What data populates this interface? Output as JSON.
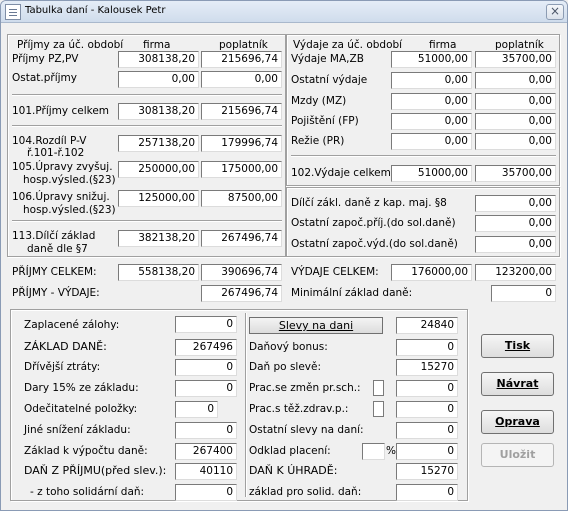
{
  "window": {
    "title": "Tabulka daní - Kalousek Petr",
    "close": "×"
  },
  "prijmy": {
    "header": "Příjmy za úč. období",
    "col_firma": "firma",
    "col_poplatnik": "poplatník",
    "pz_pv": {
      "label": "Příjmy PZ,PV",
      "firma": "308138,20",
      "poplatnik": "215696,74"
    },
    "ostat": {
      "label": "Ostat.příjmy",
      "firma": "0,00",
      "poplatnik": "0,00"
    },
    "celkem101": {
      "label": "101.Příjmy celkem",
      "firma": "308138,20",
      "poplatnik": "215696,74"
    },
    "rozdil104": {
      "label1": "104.Rozdíl P-V",
      "label2": "ř.101-ř.102",
      "firma": "257138,20",
      "poplatnik": "179996,74"
    },
    "upravy105": {
      "label1": "105.Úpravy zvyšuj.",
      "label2": "hosp.výsled.(§23)",
      "firma": "250000,00",
      "poplatnik": "175000,00"
    },
    "upravy106": {
      "label1": "106.Úpravy snižuj.",
      "label2": "hosp.výsled.(§23)",
      "firma": "125000,00",
      "poplatnik": "87500,00"
    },
    "zaklad113": {
      "label1": "113.Dílčí základ",
      "label2": "daně dle §7",
      "firma": "382138,20",
      "poplatnik": "267496,74"
    }
  },
  "vydaje": {
    "header": "Výdaje za úč. období",
    "col_firma": "firma",
    "col_poplatnik": "poplatník",
    "ma_zb": {
      "label": "Výdaje MA,ZB",
      "firma": "51000,00",
      "poplatnik": "35700,00"
    },
    "ostatni": {
      "label": "Ostatní výdaje",
      "firma": "0,00",
      "poplatnik": "0,00"
    },
    "mzdy": {
      "label": "Mzdy (MZ)",
      "firma": "0,00",
      "poplatnik": "0,00"
    },
    "pojisteni": {
      "label": "Pojištění (FP)",
      "firma": "0,00",
      "poplatnik": "0,00"
    },
    "rezie": {
      "label": "Režie (PR)",
      "firma": "0,00",
      "poplatnik": "0,00"
    },
    "celkem102": {
      "label": "102.Výdaje celkem",
      "firma": "51000,00",
      "poplatnik": "35700,00"
    }
  },
  "dilci": {
    "kap8": {
      "label": "Dílčí zákl. daně z kap. maj. §8",
      "value": "0,00"
    },
    "ostat_prij": {
      "label": "Ostatní započ.příj.(do sol.daně)",
      "value": "0,00"
    },
    "ostat_vyd": {
      "label": "Ostatní započ.výd.(do sol.daně)",
      "value": "0,00"
    }
  },
  "totals": {
    "prijmy_celkem": {
      "label": "PŘÍJMY CELKEM:",
      "firma": "558138,20",
      "poplatnik": "390696,74"
    },
    "vydaje_celkem": {
      "label": "VÝDAJE CELKEM:",
      "firma": "176000,00",
      "poplatnik": "123200,00"
    },
    "prijmy_vydaje": {
      "label": "PŘÍJMY - VÝDAJE:",
      "value": "267496,74"
    },
    "min_zaklad": {
      "label": "Minimální základ daně:",
      "value": "0"
    }
  },
  "tax_left": {
    "zalohy": {
      "label": "Zaplacené zálohy:",
      "value": "0"
    },
    "zaklad_dane": {
      "label": "ZÁKLAD DANĚ:",
      "value": "267496"
    },
    "dr_ztraty": {
      "label": "Dřívější ztráty:",
      "value": "0"
    },
    "dary": {
      "label": "Dary 15% ze základu:",
      "value": "0"
    },
    "odecitatelne": {
      "label": "Odečitatelné položky:",
      "value": "0"
    },
    "jine": {
      "label": "Jiné snížení základu:",
      "value": "0"
    },
    "zaklad_vypocet": {
      "label": "Základ k výpočtu daně:",
      "value": "267400"
    },
    "dan_z_prijmu": {
      "label": "DAŇ Z PŘÍJMU(před slev.):",
      "value": "40110"
    },
    "solidarni": {
      "label": "- z toho solidární daň:",
      "value": "0"
    }
  },
  "tax_right": {
    "slevy_button": "Slevy na dani",
    "slevy_value": "24840",
    "bonus": {
      "label": "Daňový bonus:",
      "value": "0"
    },
    "po_sleve": {
      "label": "Daň po slevě:",
      "value": "15270"
    },
    "prac_zmen": {
      "label": "Prac.se změn pr.sch.:",
      "value": "0"
    },
    "prac_zdrav": {
      "label": "Prac.s těž.zdrav.p.:",
      "value": "0"
    },
    "ostatni_slevy": {
      "label": "Ostatní slevy na daní:",
      "value": "0"
    },
    "odklad": {
      "label": "Odklad placení:",
      "percent": "",
      "percent_sign": "%",
      "value": "0"
    },
    "k_uhrade": {
      "label": "DAŇ K ÚHRADĚ:",
      "value": "15270"
    },
    "solid_zaklad": {
      "label": "základ pro solid. daň:",
      "value": "0"
    }
  },
  "buttons": {
    "tisk": "Tisk",
    "navrat": "Návrat",
    "oprava": "Oprava",
    "ulozit": "Uložit"
  }
}
